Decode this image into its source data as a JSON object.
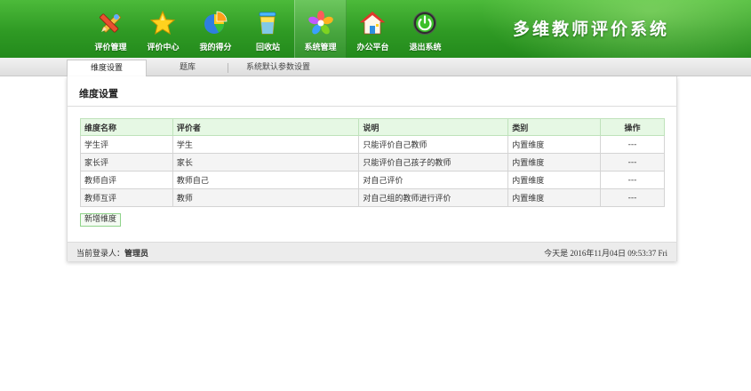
{
  "app": {
    "title": "多维教师评价系统"
  },
  "nav": {
    "items": [
      {
        "label": "评价管理",
        "icon": "pencil-ruler-icon"
      },
      {
        "label": "评价中心",
        "icon": "star-icon"
      },
      {
        "label": "我的得分",
        "icon": "pie-chart-icon"
      },
      {
        "label": "回收站",
        "icon": "recycle-bin-icon"
      },
      {
        "label": "系统管理",
        "icon": "flower-icon",
        "active": true
      },
      {
        "label": "办公平台",
        "icon": "house-icon"
      },
      {
        "label": "退出系统",
        "icon": "power-icon"
      }
    ]
  },
  "tabs": [
    {
      "label": "维度设置",
      "active": true
    },
    {
      "label": "题库"
    },
    {
      "label": "系统默认参数设置"
    }
  ],
  "panel": {
    "title": "维度设置"
  },
  "table": {
    "headers": [
      "维度名称",
      "评价者",
      "说明",
      "类别",
      "操作"
    ],
    "rows": [
      [
        "学生评",
        "学生",
        "只能评价自己教师",
        "内置维度",
        "---"
      ],
      [
        "家长评",
        "家长",
        "只能评价自己孩子的教师",
        "内置维度",
        "---"
      ],
      [
        "教师自评",
        "教师自己",
        "对自己评价",
        "内置维度",
        "---"
      ],
      [
        "教师互评",
        "教师",
        "对自己组的教师进行评价",
        "内置维度",
        "---"
      ]
    ]
  },
  "add_button": {
    "label": "新增维度"
  },
  "footer": {
    "login_label": "当前登录人：",
    "login_user": "管理员",
    "date_text": "今天是 2016年11月04日  09:53:37 Fri"
  },
  "colors": {
    "header_green": "#2f9a24",
    "header_bg": "#e6f8e4",
    "accent_border": "#8fd38a"
  }
}
